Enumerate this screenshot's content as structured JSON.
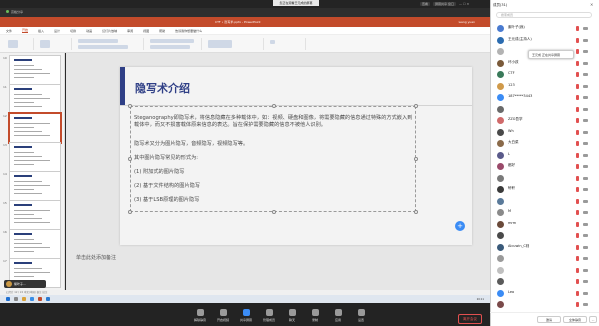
{
  "share_bar": {
    "status": "您正在观看王元成的屏幕",
    "view_label": "查看",
    "layout_label": "屏幕共享 窗口",
    "window_btns": "— ☐ ✕"
  },
  "host_bar": {
    "text": "高格分享"
  },
  "ppt": {
    "window_title": "CTF • 隐写术.pptx - PowerPoint",
    "user": "wang yuan",
    "tabs": [
      "文件",
      "开始",
      "插入",
      "设计",
      "切换",
      "动画",
      "幻灯片放映",
      "审阅",
      "视图",
      "帮助",
      "告诉我你想要做什么"
    ],
    "active_tab": "开始",
    "thumb_numbers": [
      "10",
      "11",
      "12",
      "13",
      "14",
      "15",
      "16",
      "17"
    ],
    "slide": {
      "title": "隐写术介绍",
      "para1": "Steganography即隐写术，将信息隐藏在多种载体中，如：视频、硬盘和图像，将需要隐藏的信息通过特殊的方式嵌入到载体中，而又不损害载体原来信息的表达。旨在保护需要隐藏的信息不被他人识别。",
      "para2": "隐写术又分为图片隐写，音频隐写，视频隐写等。",
      "para3": "其中图片隐写常见的形式为:",
      "items": [
        "(1) 附加式的图片隐写",
        "(2) 基于文件结构的图片隐写",
        "(3) 基于LSB原理的图片隐写"
      ]
    },
    "notes_placeholder": "单击此处添加备注",
    "add_symbol": "+",
    "status": "幻灯片 12 / 24    中文(中国)    备注  批注",
    "time": "20:11",
    "float_chip": "紫叶子..."
  },
  "dock": {
    "items": [
      "解除静音",
      "开启视频",
      "共享屏幕",
      "管理成员",
      "聊天",
      "录制",
      "应用",
      "设置"
    ],
    "end_meeting": "离开会议"
  },
  "panel": {
    "title": "成员(31)",
    "close": "✕",
    "search_placeholder": "搜索成员",
    "tooltip": "王元成 正在共享屏幕",
    "members": [
      {
        "name": "紫叶子(我)",
        "color": "#4a7bd0"
      },
      {
        "name": "王元成(主持人)",
        "color": "#2b6cb0"
      },
      {
        "name": "",
        "color": "#b3b3b3"
      },
      {
        "name": "坏小孩",
        "color": "#7a5a3a"
      },
      {
        "name": "CTF",
        "color": "#3a7a5a"
      },
      {
        "name": "123",
        "color": "#d09a4a"
      },
      {
        "name": "187*****3443",
        "color": "#3b8cf5"
      },
      {
        "name": "",
        "color": "#6a6a6a"
      },
      {
        "name": "ZZG吾学",
        "color": "#d06a6a"
      },
      {
        "name": "Wh",
        "color": "#4a4a4a"
      },
      {
        "name": "大白菜",
        "color": "#8a6a4a"
      },
      {
        "name": "L",
        "color": "#5a5a8a"
      },
      {
        "name": "都好",
        "color": "#9a4a6a"
      },
      {
        "name": "",
        "color": "#7a7a7a"
      },
      {
        "name": "轩轩",
        "color": "#3a3a3a"
      },
      {
        "name": "",
        "color": "#5a7a9a"
      },
      {
        "name": "M",
        "color": "#8a8a8a"
      },
      {
        "name": "mrm",
        "color": "#6a4a3a"
      },
      {
        "name": "",
        "color": "#4a4a4a"
      },
      {
        "name": "Alcuwin_C则",
        "color": "#3a5a7a"
      },
      {
        "name": "",
        "color": "#9a9a9a"
      },
      {
        "name": "",
        "color": "#c0c0c0"
      },
      {
        "name": "",
        "color": "#5a5a5a"
      },
      {
        "name": "Leo",
        "color": "#3b8cf5"
      },
      {
        "name": "",
        "color": "#7a4a4a"
      }
    ],
    "btn_invite": "邀请",
    "btn_mute_all": "全体静音",
    "btn_more": "..."
  }
}
